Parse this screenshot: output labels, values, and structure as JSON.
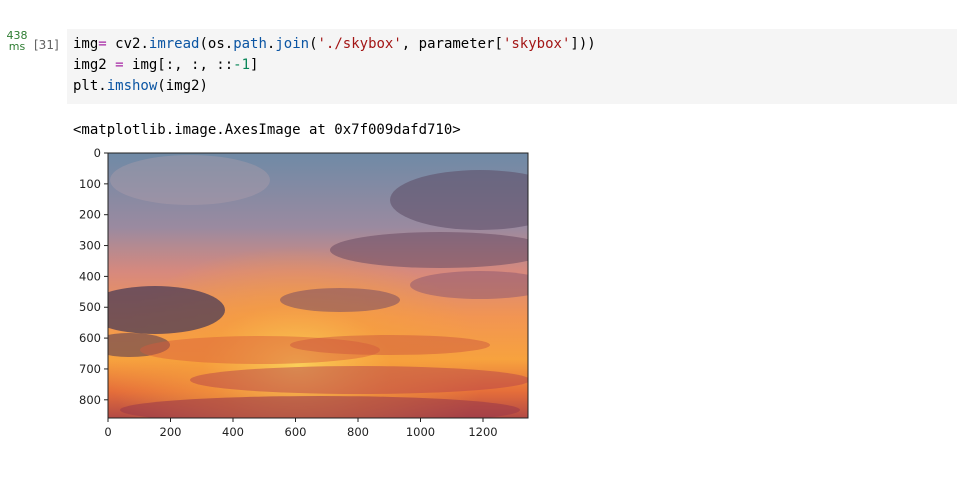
{
  "cell": {
    "exec_time_value": "438",
    "exec_time_unit": "ms",
    "exec_count": "[31]"
  },
  "code": {
    "line1": {
      "a": "img",
      "b": "=",
      "c": " cv2.",
      "d": "imread",
      "e": "(os.",
      "f": "path",
      "g": ".",
      "h": "join",
      "i": "(",
      "j": "'./skybox'",
      "k": ", parameter[",
      "l": "'skybox'",
      "m": "]))"
    },
    "line2": {
      "a": "img2 ",
      "b": "=",
      "c": " img[:, :, ::",
      "d": "-1",
      "e": "]"
    },
    "line3": {
      "a": "plt.",
      "b": "imshow",
      "c": "(img2)"
    }
  },
  "output": {
    "repr": "<matplotlib.image.AxesImage at 0x7f009dafd710>"
  },
  "chart_data": {
    "type": "image",
    "image_description": "sunset sky with orange and purple clouds",
    "xlim": [
      0,
      1344
    ],
    "ylim": [
      859,
      0
    ],
    "x_ticks": [
      0,
      200,
      400,
      600,
      800,
      1000,
      1200
    ],
    "y_ticks": [
      0,
      100,
      200,
      300,
      400,
      500,
      600,
      700,
      800
    ],
    "x_tick_labels": [
      "0",
      "200",
      "400",
      "600",
      "800",
      "1000",
      "1200"
    ],
    "y_tick_labels": [
      "0",
      "100",
      "200",
      "300",
      "400",
      "500",
      "600",
      "700",
      "800"
    ]
  },
  "colors": {
    "code_bg": "#f5f5f5",
    "exec_time": "#2e7d32",
    "keyword": "#a626a4",
    "function": "#0b55a3",
    "string": "#a31515",
    "number": "#098658"
  }
}
